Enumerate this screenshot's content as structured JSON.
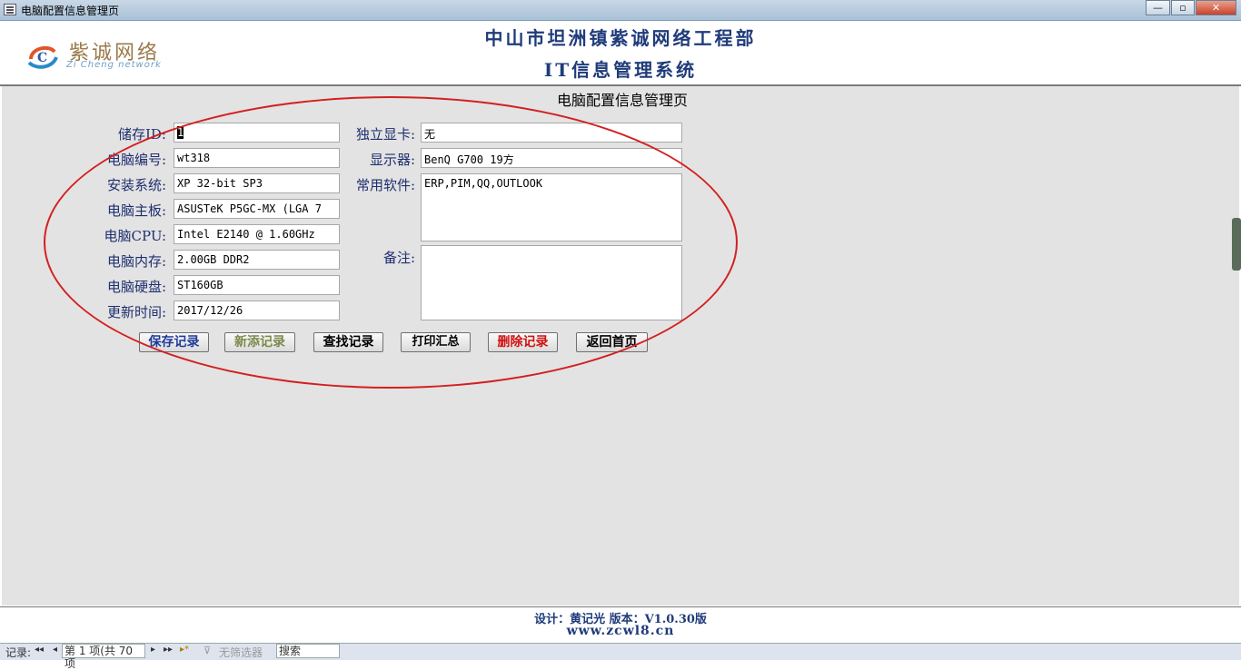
{
  "window": {
    "title": "电脑配置信息管理页",
    "min": "—",
    "max": "▫",
    "close": "✕"
  },
  "header": {
    "logo_cn": "紫诚网络",
    "logo_en": "Zi Cheng network",
    "line1": "中山市坦洲镇紫诚网络工程部",
    "line2": "IT信息管理系统"
  },
  "form": {
    "title": "电脑配置信息管理页",
    "labels": {
      "id": "储存ID:",
      "code": "电脑编号:",
      "os": "安装系统:",
      "mb": "电脑主板:",
      "cpu": "电脑CPU:",
      "ram": "电脑内存:",
      "disk": "电脑硬盘:",
      "updated": "更新时间:",
      "gpu": "独立显卡:",
      "monitor": "显示器:",
      "software": "常用软件:",
      "remark": "备注:"
    },
    "values": {
      "id": "1",
      "code": "wt318",
      "os": "XP 32-bit SP3",
      "mb": "ASUSTeK P5GC-MX (LGA 7",
      "cpu": "Intel E2140 @ 1.60GHz",
      "ram": "2.00GB  DDR2",
      "disk": "ST160GB",
      "updated": "2017/12/26",
      "gpu": "无",
      "monitor": "BenQ G700 19方",
      "software": "ERP,PIM,QQ,OUTLOOK",
      "remark": ""
    },
    "buttons": {
      "save": "保存记录",
      "new": "新添记录",
      "find": "查找记录",
      "print": "打印汇总",
      "delete": "删除记录",
      "home": "返回首页"
    },
    "colors": {
      "save": "#1f3b9a",
      "new": "#7a8a4a",
      "find": "#000000",
      "print": "#000000",
      "delete": "#d01010",
      "home": "#000000"
    }
  },
  "footer": {
    "line1": "设计：黄记光  版本：V1.0.30版",
    "line2": "www.zcwl8.cn"
  },
  "navbar": {
    "record_label": "记录:",
    "first": "◂◂",
    "prev": "◂",
    "current": "第 1 项(共 70 项",
    "next": "▸",
    "last": "▸▸",
    "new": "▸*",
    "filter": "无筛选器",
    "search": "搜索"
  }
}
